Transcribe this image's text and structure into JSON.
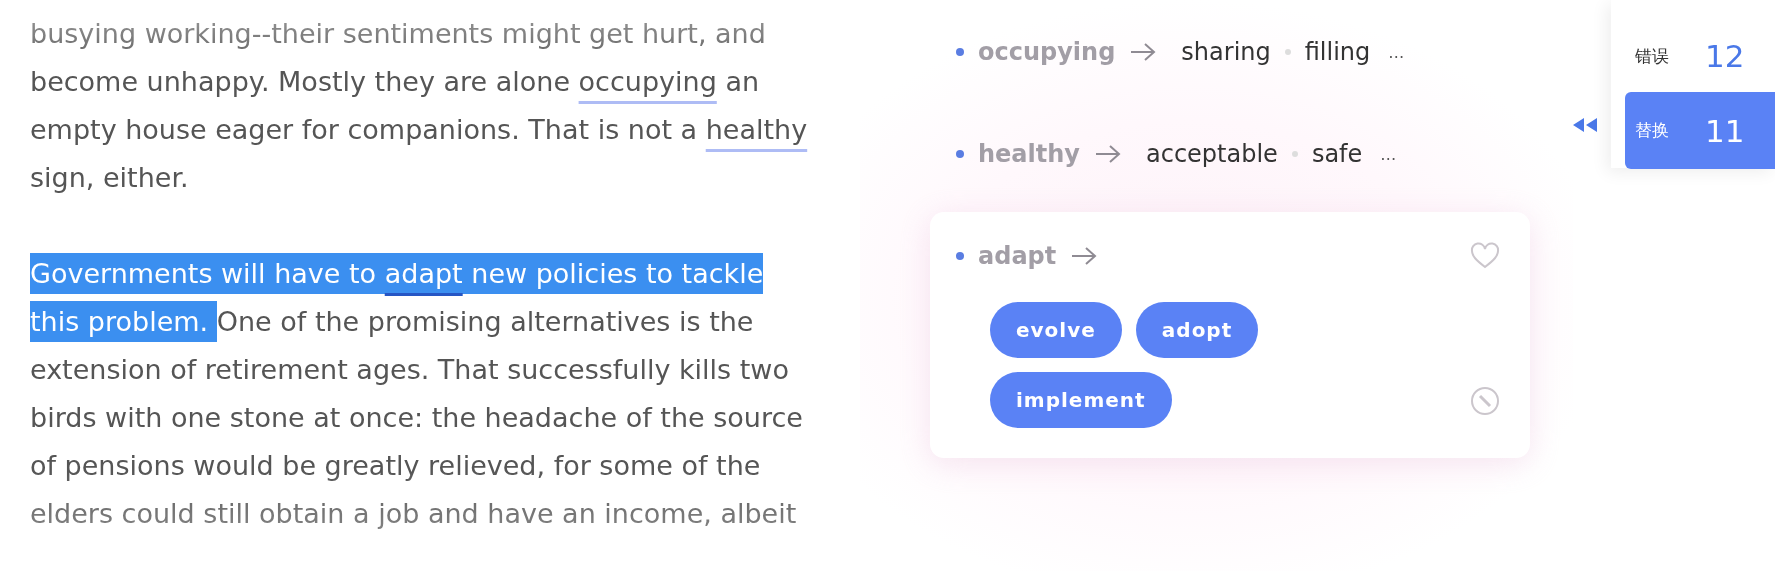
{
  "essay": {
    "paragraphs": [
      {
        "lines": [
          [
            {
              "text": "busying working--their sentiments might get hurt, and",
              "flagged": false,
              "highlighted": false
            }
          ],
          [
            {
              "text": "become unhappy. Mostly they are alone ",
              "flagged": false,
              "highlighted": false
            },
            {
              "text": "occupying",
              "flagged": true,
              "highlighted": false
            },
            {
              "text": " an",
              "flagged": false,
              "highlighted": false
            }
          ],
          [
            {
              "text": "empty house eager for companions. That is not a ",
              "flagged": false,
              "highlighted": false
            },
            {
              "text": "healthy",
              "flagged": true,
              "highlighted": false
            }
          ],
          [
            {
              "text": "sign, either.",
              "flagged": false,
              "highlighted": false
            }
          ]
        ]
      },
      {
        "lines": [
          [
            {
              "text": "Governments will have to ",
              "flagged": false,
              "highlighted": true
            },
            {
              "text": "adapt",
              "flagged": true,
              "highlighted": true
            },
            {
              "text": " new policies to tackle ",
              "flagged": false,
              "highlighted": true
            }
          ],
          [
            {
              "text": "this problem. ",
              "flagged": false,
              "highlighted": true
            },
            {
              "text": "One of the promising alternatives is the",
              "flagged": false,
              "highlighted": false
            }
          ],
          [
            {
              "text": "extension of retirement ages. That successfully kills two",
              "flagged": false,
              "highlighted": false
            }
          ],
          [
            {
              "text": "birds with one stone at once: the headache of the source",
              "flagged": false,
              "highlighted": false
            }
          ],
          [
            {
              "text": "of pensions would be greatly relieved, for some of the",
              "flagged": false,
              "highlighted": false
            }
          ],
          [
            {
              "text": "elders could still obtain a job and have an income, albeit",
              "flagged": false,
              "highlighted": false
            }
          ]
        ]
      }
    ]
  },
  "suggestions": [
    {
      "word": "occupying",
      "expanded": false,
      "alternatives": [
        "sharing",
        "filling"
      ],
      "more": "…"
    },
    {
      "word": "healthy",
      "expanded": false,
      "alternatives": [
        "acceptable",
        "safe"
      ],
      "more": "…"
    },
    {
      "word": "adapt",
      "expanded": true,
      "alternatives": [
        "evolve",
        "adopt",
        "implement"
      ]
    }
  ],
  "tabs": [
    {
      "label": "错误",
      "count": "12",
      "selected": false
    },
    {
      "label": "替换",
      "count": "11",
      "selected": true
    }
  ]
}
